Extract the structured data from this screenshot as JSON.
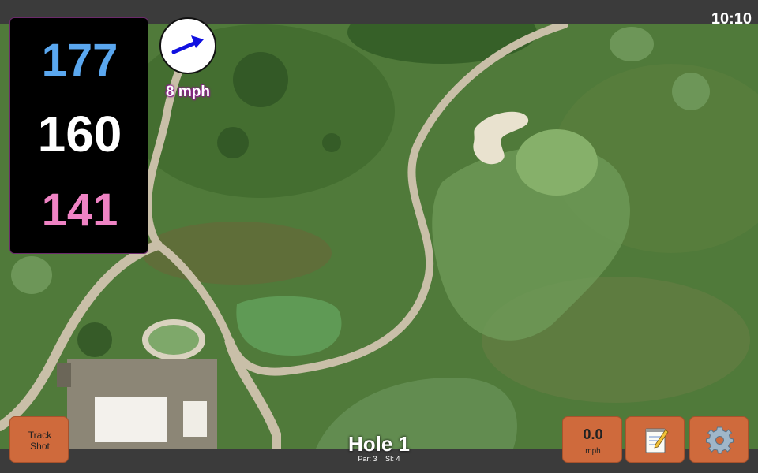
{
  "status_bar": {
    "time": "10:10"
  },
  "distances": {
    "back": "177",
    "middle": "160",
    "front": "141"
  },
  "wind": {
    "speed_label": "8 mph",
    "direction_icon": "wind-arrow-icon"
  },
  "track_shot": {
    "label": "Track\nShot"
  },
  "hole": {
    "title": "Hole 1",
    "par_label": "Par: 3",
    "si_label": "SI: 4"
  },
  "speed_display": {
    "value": "0.0",
    "unit": "mph"
  },
  "icons": {
    "notes": "notepad-icon",
    "settings": "gear-icon"
  },
  "colors": {
    "back_distance": "#5aa7ef",
    "middle_distance": "#ffffff",
    "front_distance": "#ef83c4",
    "button": "#cf6a3c",
    "accent": "#8b1f8b"
  }
}
